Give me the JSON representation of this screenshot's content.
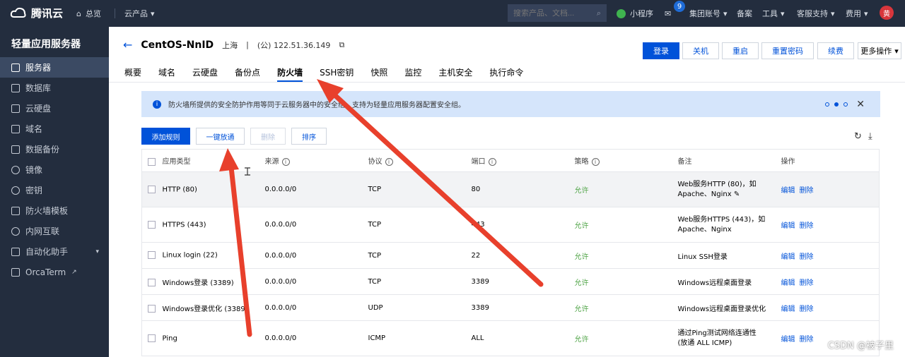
{
  "topbar": {
    "brand": "腾讯云",
    "overview": "总览",
    "products": "云产品",
    "search_placeholder": "搜索产品、文档...",
    "mini_program": "小程序",
    "message_count": "9",
    "group_account": "集团账号",
    "filing": "备案",
    "tools": "工具",
    "support": "客服支持",
    "billing": "费用",
    "avatar_text": "黄"
  },
  "sidebar": {
    "title": "轻量应用服务器",
    "items": [
      {
        "label": "服务器",
        "icon": "cube-icon"
      },
      {
        "label": "数据库",
        "icon": "database-icon"
      },
      {
        "label": "云硬盘",
        "icon": "disk-icon"
      },
      {
        "label": "域名",
        "icon": "domain-icon"
      },
      {
        "label": "数据备份",
        "icon": "backup-icon"
      },
      {
        "label": "镜像",
        "icon": "image-icon"
      },
      {
        "label": "密钥",
        "icon": "key-icon"
      },
      {
        "label": "防火墙模板",
        "icon": "shield-icon"
      },
      {
        "label": "内网互联",
        "icon": "network-icon"
      },
      {
        "label": "自动化助手",
        "icon": "automation-icon"
      },
      {
        "label": "OrcaTerm",
        "icon": "terminal-icon"
      }
    ]
  },
  "server": {
    "name": "CentOS-NnID",
    "region": "上海",
    "separator": "|",
    "ip": "(公) 122.51.36.149"
  },
  "actions": {
    "login": "登录",
    "shutdown": "关机",
    "restart": "重启",
    "reset_password": "重置密码",
    "renew": "续费",
    "more": "更多操作"
  },
  "tabs": [
    "概要",
    "域名",
    "云硬盘",
    "备份点",
    "防火墙",
    "SSH密钥",
    "快照",
    "监控",
    "主机安全",
    "执行命令"
  ],
  "active_tab": "防火墙",
  "notice": "防火墙所提供的安全防护作用等同于云服务器中的安全组，支持为轻量应用服务器配置安全组。",
  "toolbar": {
    "add_rule": "添加规则",
    "one_click_open": "一键放通",
    "delete": "删除",
    "sort": "排序"
  },
  "table": {
    "headers": [
      "应用类型",
      "来源",
      "协议",
      "端口",
      "策略",
      "备注",
      "操作"
    ],
    "rows": [
      {
        "type": "HTTP (80)",
        "source": "0.0.0.0/0",
        "protocol": "TCP",
        "port": "80",
        "policy": "允许",
        "note": "Web服务HTTP (80)，如 Apache、Nginx",
        "edit": "编辑",
        "delete": "删除"
      },
      {
        "type": "HTTPS (443)",
        "source": "0.0.0.0/0",
        "protocol": "TCP",
        "port": "443",
        "policy": "允许",
        "note": "Web服务HTTPS (443)，如 Apache、Nginx",
        "edit": "编辑",
        "delete": "删除"
      },
      {
        "type": "Linux login (22)",
        "source": "0.0.0.0/0",
        "protocol": "TCP",
        "port": "22",
        "policy": "允许",
        "note": "Linux SSH登录",
        "edit": "编辑",
        "delete": "删除"
      },
      {
        "type": "Windows登录 (3389)",
        "source": "0.0.0.0/0",
        "protocol": "TCP",
        "port": "3389",
        "policy": "允许",
        "note": "Windows远程桌面登录",
        "edit": "编辑",
        "delete": "删除"
      },
      {
        "type": "Windows登录优化 (3389)",
        "source": "0.0.0.0/0",
        "protocol": "UDP",
        "port": "3389",
        "policy": "允许",
        "note": "Windows远程桌面登录优化",
        "edit": "编辑",
        "delete": "删除"
      },
      {
        "type": "Ping",
        "source": "0.0.0.0/0",
        "protocol": "ICMP",
        "port": "ALL",
        "policy": "允许",
        "note": "通过Ping测试网络连通性 (放通 ALL ICMP)",
        "edit": "编辑",
        "delete": "删除"
      }
    ]
  },
  "watermark": "CSDN @被子里",
  "colors": {
    "primary": "#0052d9",
    "topbar": "#232d3e",
    "allow": "#4fa446",
    "annotation": "#e8402c"
  }
}
